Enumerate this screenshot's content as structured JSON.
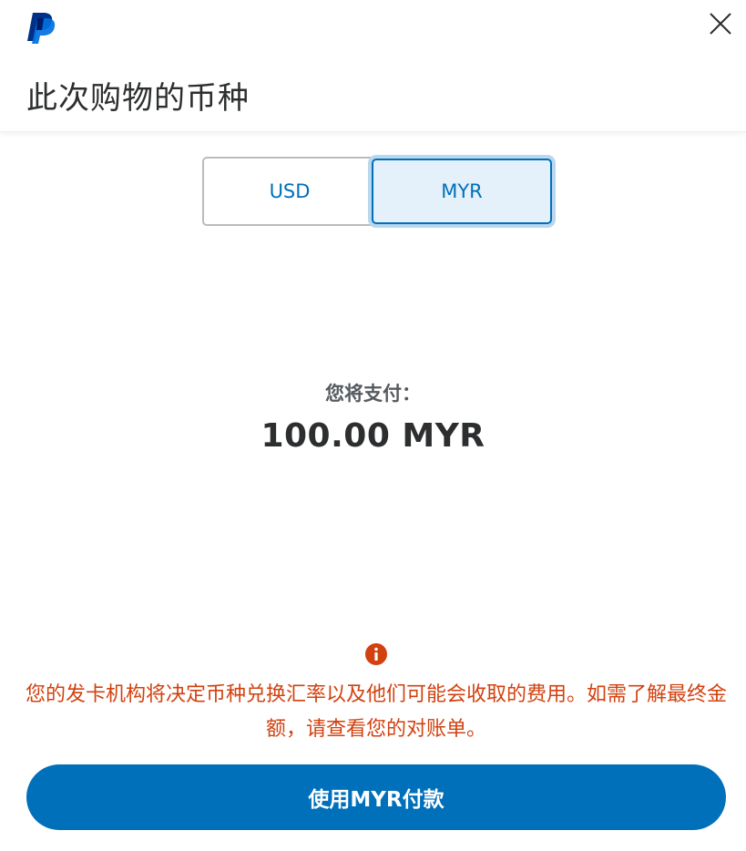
{
  "header": {
    "logo_icon": "paypal-logo-icon",
    "close_icon": "close-icon",
    "title": "此次购物的币种"
  },
  "currency_toggle": {
    "options": [
      {
        "label": "USD",
        "selected": false
      },
      {
        "label": "MYR",
        "selected": true
      }
    ]
  },
  "summary": {
    "pay_label": "您将支付：",
    "amount": "100.00 MYR"
  },
  "notice": {
    "icon": "info-icon",
    "text": "您的发卡机构将决定币种兑换汇率以及他们可能会收取的费用。如需了解最终金额，请查看您的对账单。"
  },
  "pay_button": {
    "label": "使用MYR付款"
  },
  "colors": {
    "brand_blue": "#0070ba",
    "selected_bg": "#e4f0fa",
    "warning": "#d2410f",
    "text_dark": "#2c2e2f"
  }
}
